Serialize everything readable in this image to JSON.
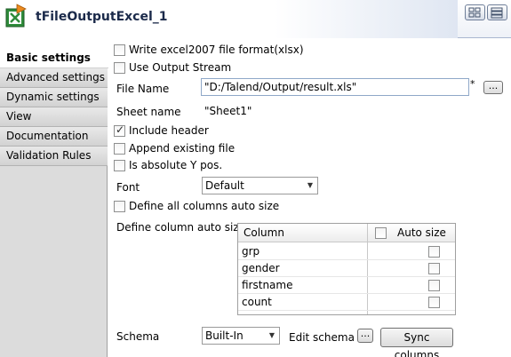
{
  "header": {
    "title": "tFileOutputExcel_1"
  },
  "sidebar": {
    "tabs": [
      {
        "label": "Basic settings",
        "active": true
      },
      {
        "label": "Advanced settings"
      },
      {
        "label": "Dynamic settings"
      },
      {
        "label": "View"
      },
      {
        "label": "Documentation"
      },
      {
        "label": "Validation Rules"
      }
    ]
  },
  "form": {
    "write_excel2007": {
      "label": "Write excel2007 file format(xlsx)",
      "checked": false
    },
    "use_output_stream": {
      "label": "Use Output Stream",
      "checked": false
    },
    "file_name": {
      "label": "File Name",
      "value": "\"D:/Talend/Output/result.xls\"",
      "modified_marker": "*",
      "browse_label": "..."
    },
    "sheet_name": {
      "label": "Sheet name",
      "value": "\"Sheet1\""
    },
    "include_header": {
      "label": "Include header",
      "checked": true
    },
    "append_existing": {
      "label": "Append existing file",
      "checked": false
    },
    "absolute_y": {
      "label": "Is absolute Y pos.",
      "checked": false
    },
    "font": {
      "label": "Font",
      "value": "Default"
    },
    "define_all_auto_size": {
      "label": "Define all columns auto size",
      "checked": false
    },
    "define_column_auto_size": {
      "label": "Define column auto size"
    },
    "schema": {
      "label": "Schema",
      "value": "Built-In"
    },
    "edit_schema_label": "Edit schema",
    "edit_schema_button": "...",
    "sync_columns_label": "Sync columns"
  },
  "auto_size_table": {
    "headers": {
      "column": "Column",
      "auto_size": "Auto size"
    },
    "rows": [
      {
        "column": "grp",
        "auto_size": false
      },
      {
        "column": "gender",
        "auto_size": false
      },
      {
        "column": "firstname",
        "auto_size": false
      },
      {
        "column": "count",
        "auto_size": false
      }
    ]
  }
}
